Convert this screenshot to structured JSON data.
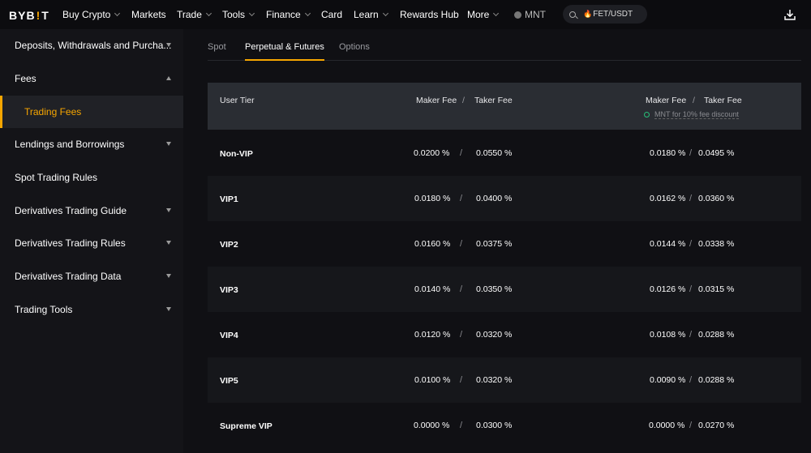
{
  "nav": {
    "logo": {
      "pre": "BYB",
      "mark": "!",
      "post": "T"
    },
    "items": [
      {
        "label": "Buy Crypto",
        "chevron": true
      },
      {
        "label": "Markets",
        "chevron": false
      },
      {
        "label": "Trade",
        "chevron": true
      },
      {
        "label": "Tools",
        "chevron": true
      },
      {
        "label": "Finance",
        "chevron": true
      },
      {
        "label": "Card",
        "chevron": false
      },
      {
        "label": "Learn",
        "chevron": true
      },
      {
        "label": "Rewards Hub",
        "chevron": false
      },
      {
        "label": "More",
        "chevron": true
      }
    ],
    "mnt_label": "MNT",
    "search_value": "FET/USDT",
    "icons": {
      "search": "search-icon",
      "hot": "fire-icon",
      "download": "download-icon"
    },
    "accent": "#f7a600"
  },
  "sidebar": {
    "items": [
      {
        "label": "Deposits, Withdrawals and Purcha...",
        "caret": "down",
        "active": false
      },
      {
        "label": "Fees",
        "caret": "up",
        "active": false
      },
      {
        "label": "Trading Fees",
        "caret": "none",
        "active": true
      },
      {
        "label": "Lendings and Borrowings",
        "caret": "down",
        "active": false
      },
      {
        "label": "Spot Trading Rules",
        "caret": "none",
        "active": false
      },
      {
        "label": "Derivatives Trading Guide",
        "caret": "down",
        "active": false
      },
      {
        "label": "Derivatives Trading Rules",
        "caret": "down",
        "active": false
      },
      {
        "label": "Derivatives Trading Data",
        "caret": "down",
        "active": false
      },
      {
        "label": "Trading Tools",
        "caret": "down",
        "active": false
      }
    ]
  },
  "tabs": [
    {
      "label": "Spot",
      "active": false
    },
    {
      "label": "Perpetual & Futures",
      "active": true
    },
    {
      "label": "Options",
      "active": false
    }
  ],
  "table": {
    "headers": {
      "tier": "User Tier",
      "maker": "Maker Fee",
      "taker": "Taker Fee",
      "maker2": "Maker Fee",
      "taker2": "Taker Fee",
      "slash": "/",
      "mnt_note": "MNT for 10% fee discount"
    },
    "rows": [
      {
        "tier": "Non-VIP",
        "maker": "0.0200 %",
        "taker": "0.0550 %",
        "maker_mnt": "0.0180 %",
        "taker_mnt": "0.0495 %"
      },
      {
        "tier": "VIP1",
        "maker": "0.0180 %",
        "taker": "0.0400 %",
        "maker_mnt": "0.0162 %",
        "taker_mnt": "0.0360 %"
      },
      {
        "tier": "VIP2",
        "maker": "0.0160 %",
        "taker": "0.0375 %",
        "maker_mnt": "0.0144 %",
        "taker_mnt": "0.0338 %"
      },
      {
        "tier": "VIP3",
        "maker": "0.0140 %",
        "taker": "0.0350 %",
        "maker_mnt": "0.0126 %",
        "taker_mnt": "0.0315 %"
      },
      {
        "tier": "VIP4",
        "maker": "0.0120 %",
        "taker": "0.0320 %",
        "maker_mnt": "0.0108 %",
        "taker_mnt": "0.0288 %"
      },
      {
        "tier": "VIP5",
        "maker": "0.0100 %",
        "taker": "0.0320 %",
        "maker_mnt": "0.0090 %",
        "taker_mnt": "0.0288 %"
      },
      {
        "tier": "Supreme VIP",
        "maker": "0.0000 %",
        "taker": "0.0300 %",
        "maker_mnt": "0.0000 %",
        "taker_mnt": "0.0270 %"
      }
    ]
  }
}
